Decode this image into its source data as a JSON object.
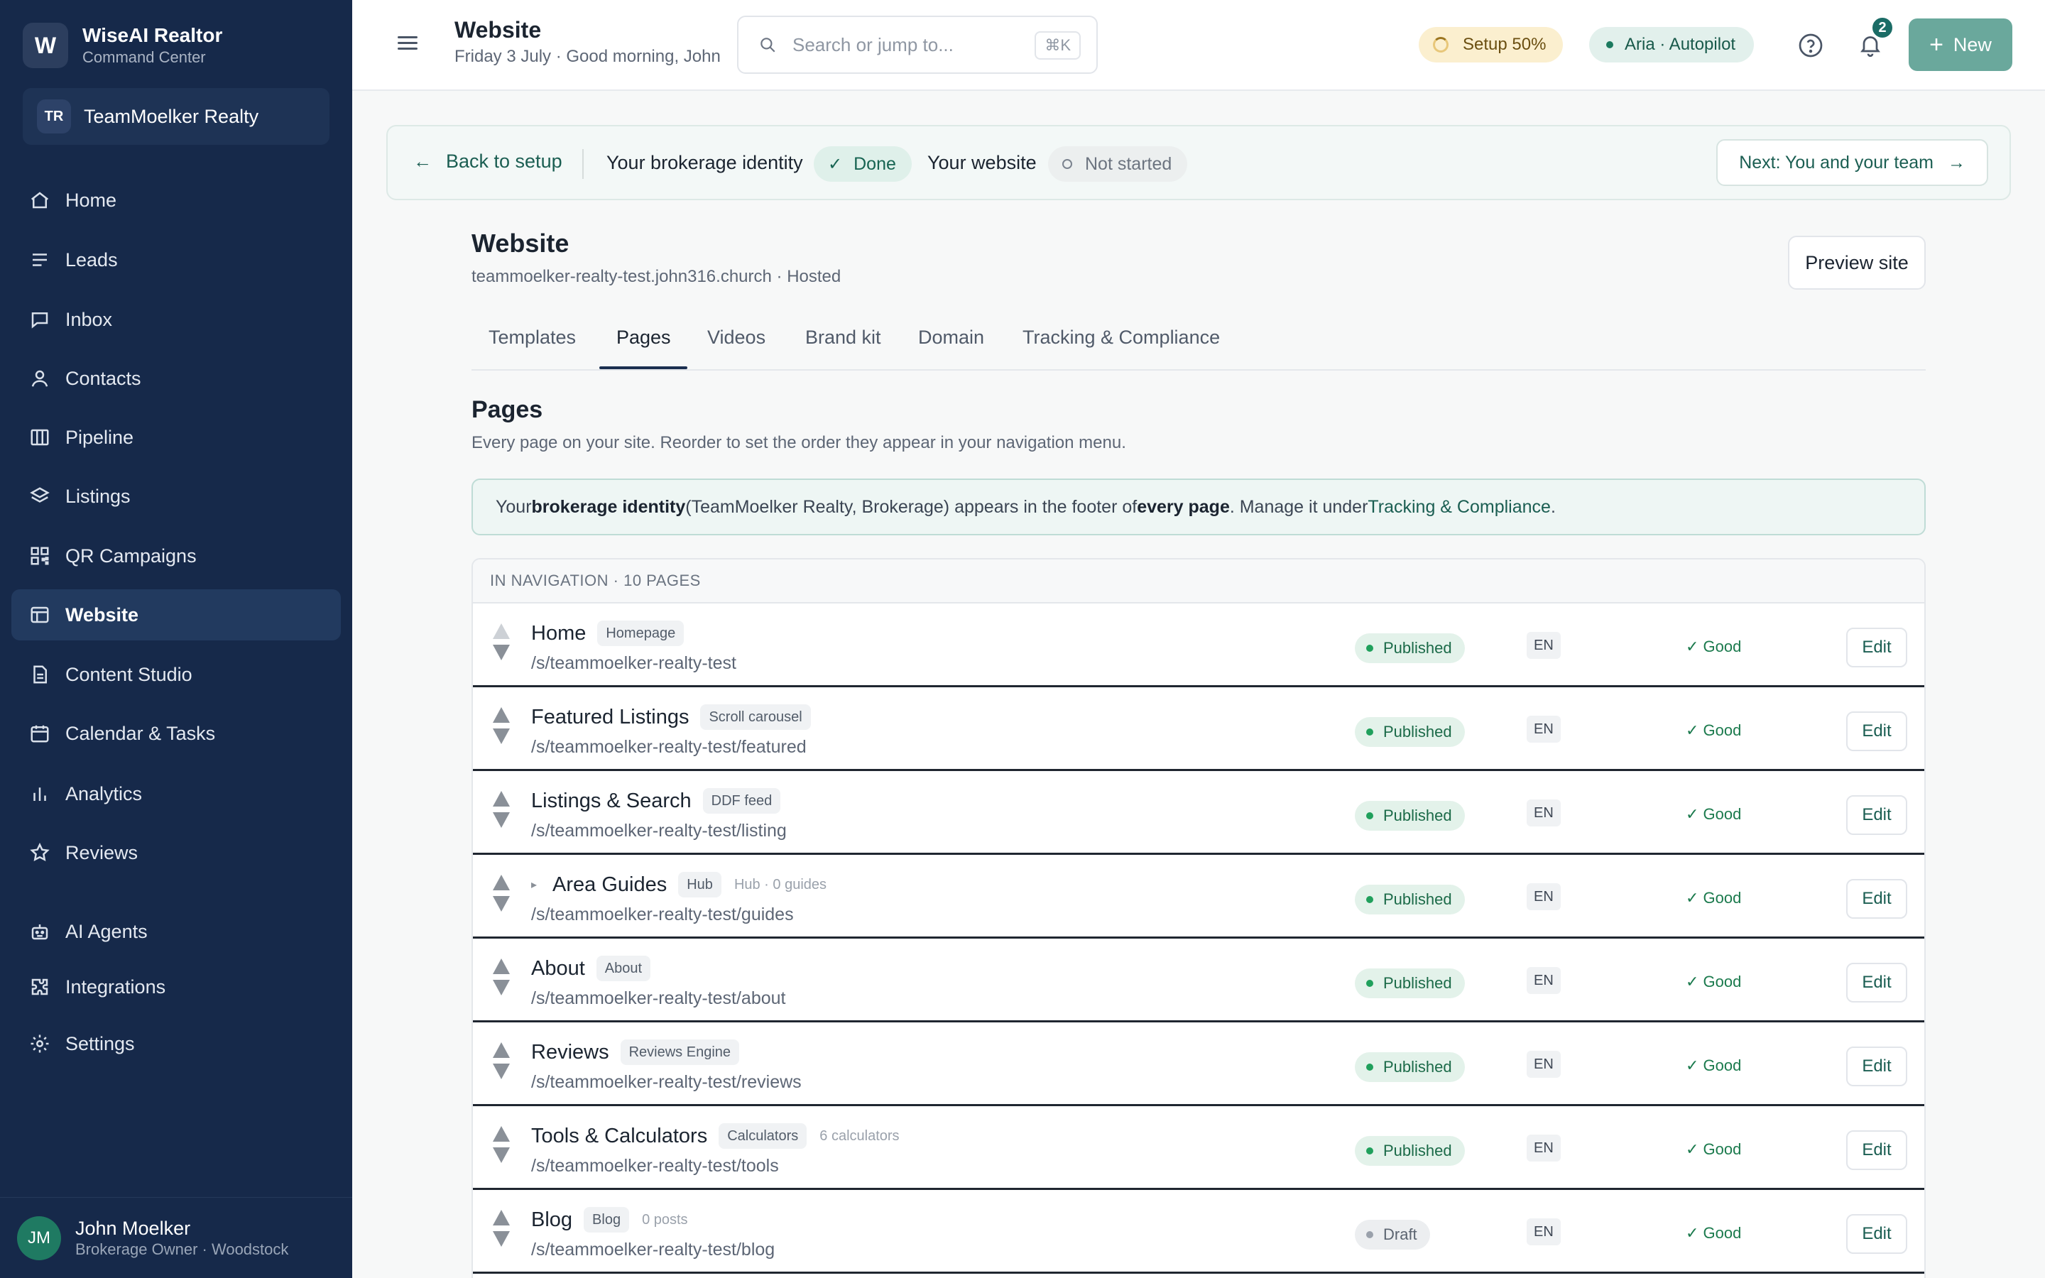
{
  "app": {
    "name": "WiseAI Realtor",
    "subtitle": "Command Center",
    "logo_letter": "W"
  },
  "team": {
    "initials": "TR",
    "name": "TeamMoelker Realty"
  },
  "nav": [
    {
      "label": "Home",
      "icon": "home-icon"
    },
    {
      "label": "Leads",
      "icon": "lines-icon"
    },
    {
      "label": "Inbox",
      "icon": "message-icon"
    },
    {
      "label": "Contacts",
      "icon": "person-icon"
    },
    {
      "label": "Pipeline",
      "icon": "columns-icon"
    },
    {
      "label": "Listings",
      "icon": "layers-icon"
    },
    {
      "label": "QR Campaigns",
      "icon": "qr-icon"
    },
    {
      "label": "Website",
      "icon": "layout-icon",
      "active": true
    },
    {
      "label": "Content Studio",
      "icon": "document-icon"
    },
    {
      "label": "Calendar & Tasks",
      "icon": "calendar-icon"
    },
    {
      "label": "Analytics",
      "icon": "bar-chart-icon"
    },
    {
      "label": "Reviews",
      "icon": "star-icon"
    },
    {
      "label": "AI Agents",
      "icon": "robot-icon"
    },
    {
      "label": "Integrations",
      "icon": "puzzle-icon"
    },
    {
      "label": "Settings",
      "icon": "gear-icon"
    }
  ],
  "user": {
    "initials": "JM",
    "name": "John Moelker",
    "role": "Brokerage Owner · Woodstock"
  },
  "topbar": {
    "title": "Website",
    "subtitle": "Friday 3 July · Good morning, John",
    "search_placeholder": "Search or jump to...",
    "search_shortcut": "⌘K",
    "setup_label": "Setup 50%",
    "aria_label": "Aria · Autopilot",
    "notification_count": "2",
    "new_label": "New"
  },
  "setup_strip": {
    "back_label": "Back to setup",
    "step1_label": "Your brokerage identity",
    "step1_status": "Done",
    "step2_label": "Your website",
    "step2_status": "Not started",
    "next_label": "Next: You and your team"
  },
  "website": {
    "title": "Website",
    "subtitle": "teammoelker-realty-test.john316.church · Hosted",
    "preview_label": "Preview site",
    "tabs": [
      "Templates",
      "Pages",
      "Videos",
      "Brand kit",
      "Domain",
      "Tracking & Compliance"
    ],
    "active_tab": "Pages"
  },
  "pages_section": {
    "title": "Pages",
    "subtitle": "Every page on your site. Reorder to set the order they appear in your navigation menu.",
    "notice": {
      "p1": "Your ",
      "b1": "brokerage identity",
      "p2": " (TeamMoelker Realty, Brokerage) appears in the footer of ",
      "b2": "every page",
      "p3": ". Manage it under ",
      "link": "Tracking & Compliance",
      "p4": "."
    },
    "table_header": "IN NAVIGATION · 10 PAGES",
    "rows": [
      {
        "name": "Home",
        "tag": "Homepage",
        "meta": "",
        "path": "/s/teammoelker-realty-test",
        "status": "Published",
        "lang": "EN",
        "seo": "✓ Good",
        "action": "Edit",
        "expandable": false,
        "first": true
      },
      {
        "name": "Featured Listings",
        "tag": "Scroll carousel",
        "meta": "",
        "path": "/s/teammoelker-realty-test/featured",
        "status": "Published",
        "lang": "EN",
        "seo": "✓ Good",
        "action": "Edit",
        "expandable": false
      },
      {
        "name": "Listings & Search",
        "tag": "DDF feed",
        "meta": "",
        "path": "/s/teammoelker-realty-test/listing",
        "status": "Published",
        "lang": "EN",
        "seo": "✓ Good",
        "action": "Edit",
        "expandable": false
      },
      {
        "name": "Area Guides",
        "tag": "Hub",
        "meta": "Hub · 0 guides",
        "path": "/s/teammoelker-realty-test/guides",
        "status": "Published",
        "lang": "EN",
        "seo": "✓ Good",
        "action": "Edit",
        "expandable": true
      },
      {
        "name": "About",
        "tag": "About",
        "meta": "",
        "path": "/s/teammoelker-realty-test/about",
        "status": "Published",
        "lang": "EN",
        "seo": "✓ Good",
        "action": "Edit",
        "expandable": false
      },
      {
        "name": "Reviews",
        "tag": "Reviews Engine",
        "meta": "",
        "path": "/s/teammoelker-realty-test/reviews",
        "status": "Published",
        "lang": "EN",
        "seo": "✓ Good",
        "action": "Edit",
        "expandable": false
      },
      {
        "name": "Tools & Calculators",
        "tag": "Calculators",
        "meta": "6 calculators",
        "path": "/s/teammoelker-realty-test/tools",
        "status": "Published",
        "lang": "EN",
        "seo": "✓ Good",
        "action": "Edit",
        "expandable": false
      },
      {
        "name": "Blog",
        "tag": "Blog",
        "meta": "0 posts",
        "path": "/s/teammoelker-realty-test/blog",
        "status": "Draft",
        "lang": "EN",
        "seo": "✓ Good",
        "action": "Edit",
        "expandable": false
      }
    ]
  },
  "colors": {
    "sidebar_bg": "#16294a",
    "accent_teal": "#1b5e52",
    "new_button": "#6aa89c",
    "published_green": "#20a05c"
  }
}
